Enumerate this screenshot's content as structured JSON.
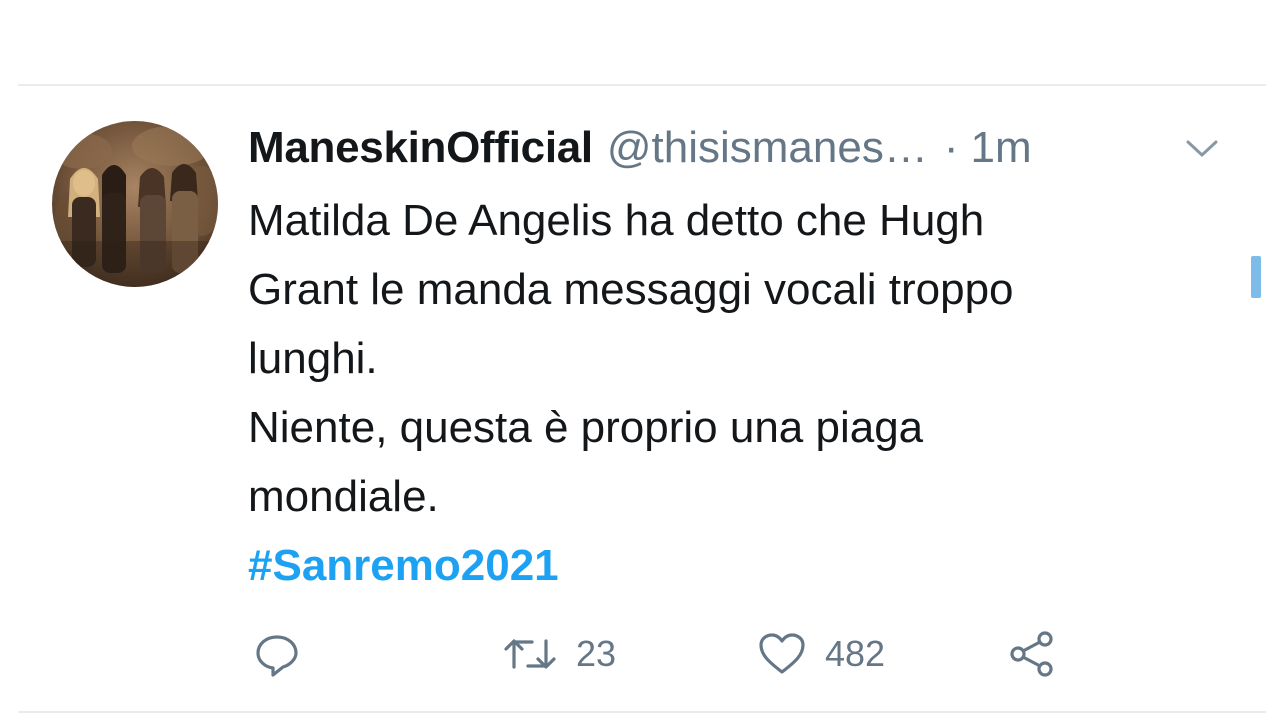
{
  "tweet": {
    "display_name": "ManeskinOfficial",
    "handle": "@thisismanes…",
    "separator": "·",
    "time": "1m",
    "text_lines": [
      "Matilda De Angelis ha detto che Hugh",
      "Grant le manda messaggi vocali troppo",
      "lunghi.",
      "Niente, questa è proprio una piaga",
      "mondiale."
    ],
    "hashtag": "#Sanremo2021"
  },
  "actions": {
    "reply": {
      "icon": "reply-icon",
      "count": ""
    },
    "retweet": {
      "icon": "retweet-icon",
      "count": "23"
    },
    "like": {
      "icon": "heart-icon",
      "count": "482"
    },
    "share": {
      "icon": "share-icon",
      "count": ""
    }
  },
  "colors": {
    "text": "#14171a",
    "secondary": "#657786",
    "accent": "#1da1f2",
    "divider": "#e6ecf0"
  }
}
